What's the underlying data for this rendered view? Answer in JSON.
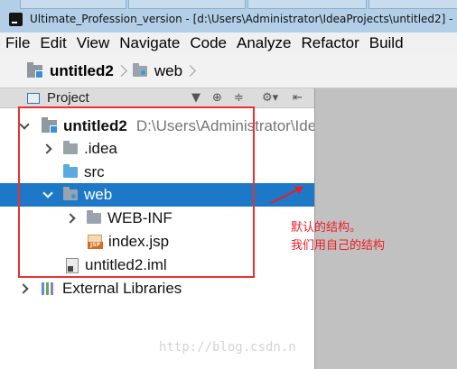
{
  "window": {
    "title": "Ultimate_Profession_version - [d:\\Users\\Administrator\\IdeaProjects\\untitled2] - Ir"
  },
  "menu": [
    "File",
    "Edit",
    "View",
    "Navigate",
    "Code",
    "Analyze",
    "Refactor",
    "Build"
  ],
  "breadcrumb": [
    "untitled2",
    "web"
  ],
  "project_panel": {
    "title": "Project",
    "tree": [
      {
        "label": "untitled2",
        "path": "D:\\Users\\Administrator\\Ide",
        "expanded": true,
        "icon": "module-icon",
        "selected": false
      },
      {
        "label": ".idea",
        "expanded": false,
        "icon": "folder-icon",
        "selected": false
      },
      {
        "label": "src",
        "icon": "source-folder-icon",
        "selected": false
      },
      {
        "label": "web",
        "expanded": true,
        "icon": "web-folder-icon",
        "selected": true
      },
      {
        "label": "WEB-INF",
        "expanded": false,
        "icon": "folder-icon",
        "selected": false
      },
      {
        "label": "index.jsp",
        "icon": "jsp-file-icon",
        "selected": false
      },
      {
        "label": "untitled2.iml",
        "icon": "iml-file-icon",
        "selected": false
      },
      {
        "label": "External Libraries",
        "expanded": false,
        "icon": "libraries-icon",
        "selected": false
      }
    ]
  },
  "annotation": {
    "line1": "默认的结构。",
    "line2": "我们用自己的结构",
    "color": "#ee1c25"
  },
  "watermark": "http://blog.csdn.n",
  "colors": {
    "selection": "#1e78c8",
    "annotation_box": "#e8322f",
    "editor_background": "#c1c1c1"
  }
}
